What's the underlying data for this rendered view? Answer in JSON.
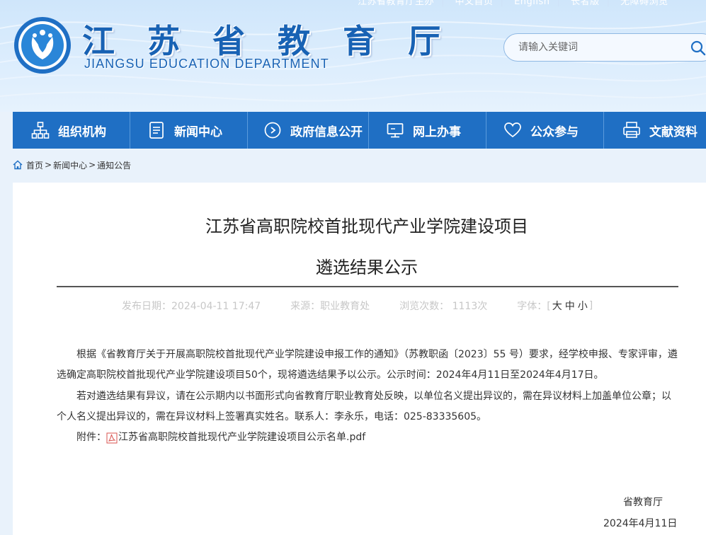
{
  "header": {
    "top_links": [
      "江苏省教育厅主办",
      "中文首页",
      "English",
      "长者版",
      "无障碍浏览"
    ],
    "logo_cn": "江 苏 省 教 育 厅",
    "logo_en": "JIANGSU EDUCATION DEPARTMENT",
    "search_placeholder": "请输入关键词"
  },
  "nav": {
    "items": [
      {
        "label": "组织机构",
        "icon": "org-chart-icon"
      },
      {
        "label": "新闻中心",
        "icon": "document-icon"
      },
      {
        "label": "政府信息公开",
        "icon": "compass-icon"
      },
      {
        "label": "网上办事",
        "icon": "monitor-icon"
      },
      {
        "label": "公众参与",
        "icon": "heart-icon"
      },
      {
        "label": "文献资料",
        "icon": "printer-icon"
      }
    ]
  },
  "breadcrumb": {
    "home": "首页",
    "sep": ">",
    "news": "新闻中心",
    "notice": "通知公告"
  },
  "article": {
    "title_line1": "江苏省高职院校首批现代产业学院建设项目",
    "title_line2": "遴选结果公示",
    "meta": {
      "date": "发布日期：2024-04-11 17:47",
      "source": "来源：职业教育处",
      "views": "浏览次数： 1113次",
      "font_label": "字体：[",
      "font_large": "大",
      "font_medium": "中",
      "font_small": "小",
      "font_close": "]"
    },
    "para1": "根据《省教育厅关于开展高职院校首批现代产业学院建设申报工作的通知》（苏教职函〔2023〕55 号）要求，经学校申报、专家评审，遴选确定高职院校首批现代产业学院建设项目50个，现将遴选结果予以公示。公示时间：2024年4月11日至2024年4月17日。",
    "para2": "若对遴选结果有异议，请在公示期内以书面形式向省教育厅职业教育处反映，以单位名义提出异议的，需在异议材料上加盖单位公章；以个人名义提出异议的，需在异议材料上签署真实姓名。联系人：李永乐，电话：025-83335605。",
    "attachment_label": "附件：",
    "attachment_name": "江苏省高职院校首批现代产业学院建设项目公示名单.pdf",
    "sign_org": "省教育厅",
    "sign_date": "2024年4月11日"
  },
  "colors": {
    "nav_bg": "#1f6fc4",
    "brand_blue": "#1862b4",
    "page_bg": "#e9f2fb"
  }
}
